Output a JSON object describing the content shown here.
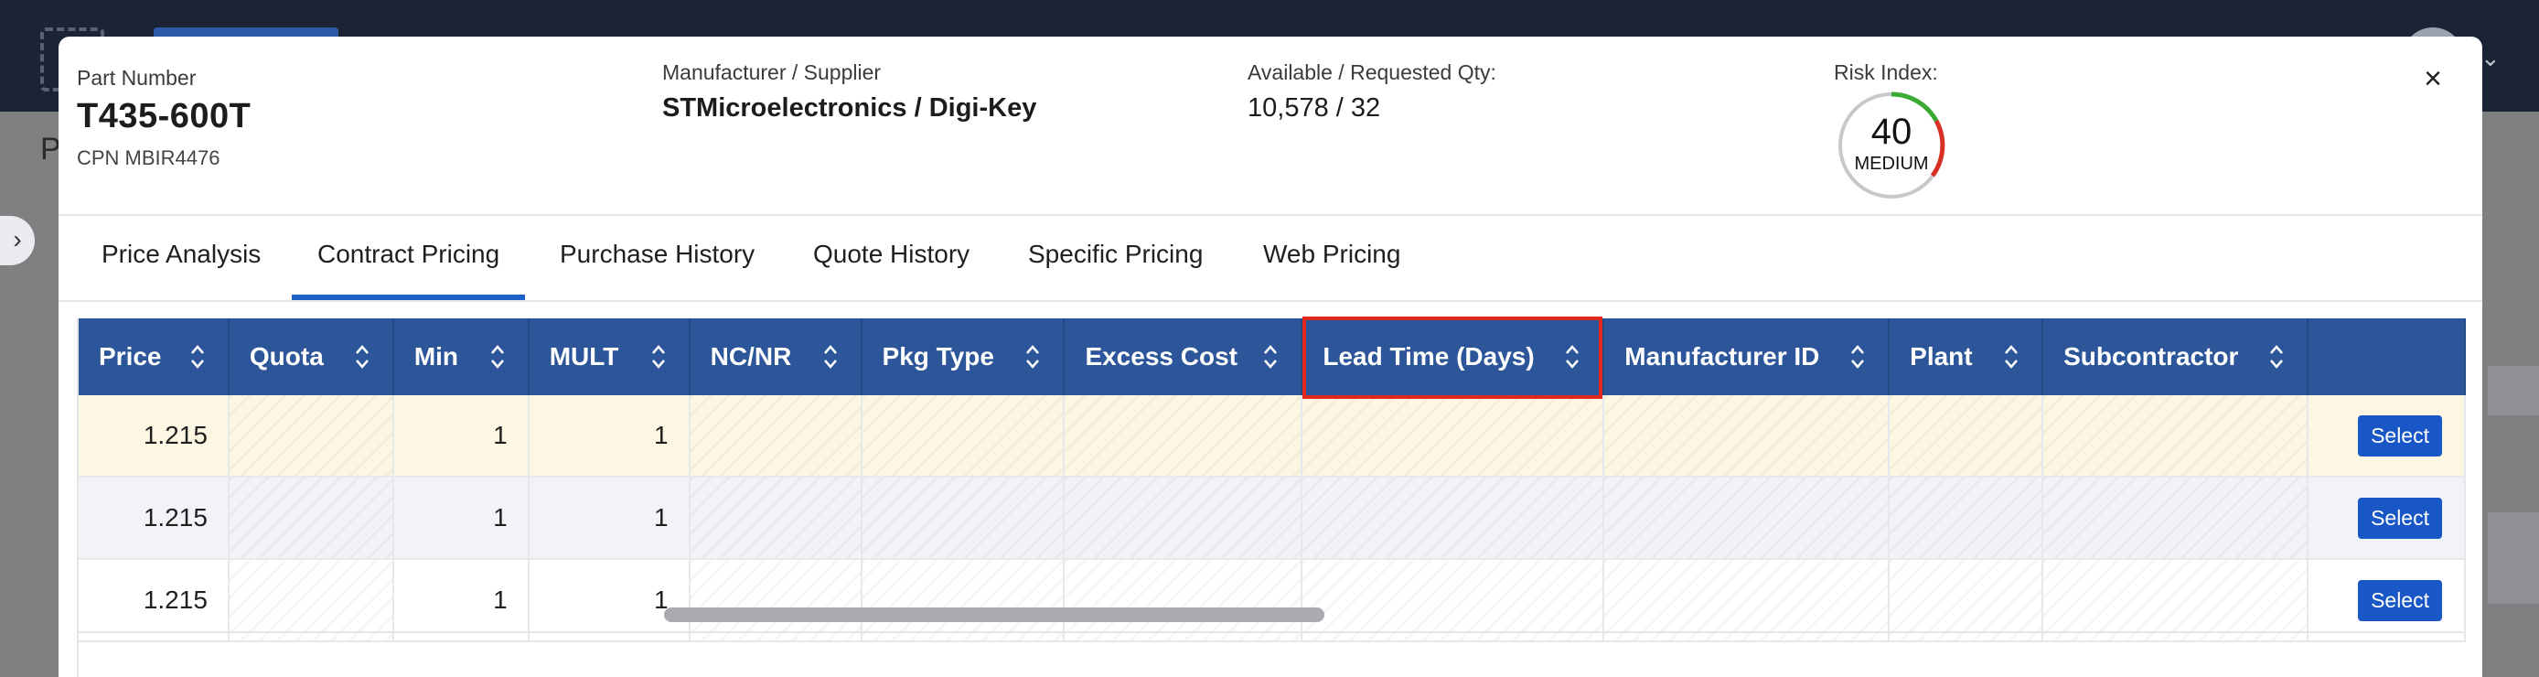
{
  "background": {
    "page_initial": "P"
  },
  "header": {
    "part_number_label": "Part Number",
    "part_number": "T435-600T",
    "cpn": "CPN MBIR4476",
    "manufacturer_label": "Manufacturer / Supplier",
    "manufacturer_value": "STMicroelectronics / Digi-Key",
    "qty_label": "Available / Requested Qty:",
    "qty_value": "10,578 / 32",
    "risk_label": "Risk Index:",
    "risk_value": "40",
    "risk_level": "MEDIUM",
    "risk_fraction": 0.4,
    "close_symbol": "×"
  },
  "tabs": [
    {
      "label": "Price Analysis",
      "active": false
    },
    {
      "label": "Contract Pricing",
      "active": true
    },
    {
      "label": "Purchase History",
      "active": false
    },
    {
      "label": "Quote History",
      "active": false
    },
    {
      "label": "Specific Pricing",
      "active": false
    },
    {
      "label": "Web Pricing",
      "active": false
    }
  ],
  "table": {
    "columns": [
      "Price",
      "Quota",
      "Min",
      "MULT",
      "NC/NR",
      "Pkg Type",
      "Excess Cost",
      "Lead Time (Days)",
      "Manufacturer ID",
      "Plant",
      "Subcontractor",
      ""
    ],
    "rows": [
      {
        "price": "1.215",
        "quota": "",
        "min": "1",
        "mult": "1",
        "ncnr": "",
        "pkg": "",
        "excess": "",
        "lead": "",
        "mfr_id": "",
        "plant": "",
        "sub": "",
        "action": "Select"
      },
      {
        "price": "1.215",
        "quota": "",
        "min": "1",
        "mult": "1",
        "ncnr": "",
        "pkg": "",
        "excess": "",
        "lead": "",
        "mfr_id": "",
        "plant": "",
        "sub": "",
        "action": "Select"
      },
      {
        "price": "1.215",
        "quota": "",
        "min": "1",
        "mult": "1",
        "ncnr": "",
        "pkg": "",
        "excess": "",
        "lead": "",
        "mfr_id": "",
        "plant": "",
        "sub": "",
        "action": "Select"
      }
    ],
    "highlighted_column": "Lead Time (Days)"
  },
  "colors": {
    "header_bg": "#2c5699",
    "accent": "#1e5fc8",
    "highlight": "#e0281f",
    "gauge_green": "#3aaa35",
    "gauge_red": "#d93025"
  }
}
